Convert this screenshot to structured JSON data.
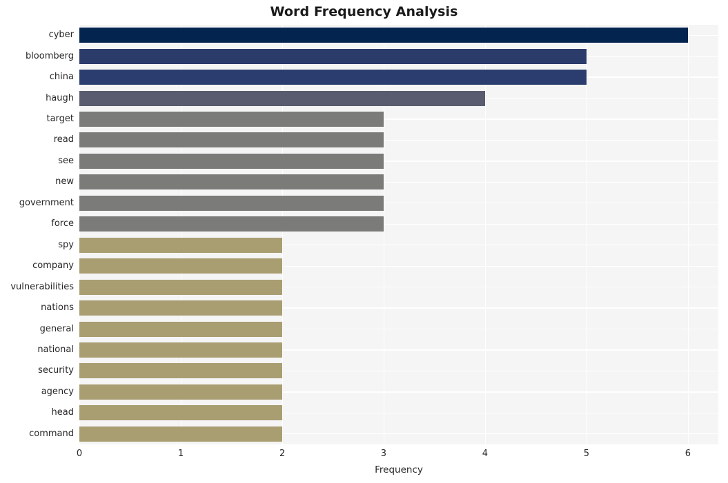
{
  "chart_data": {
    "type": "bar",
    "orientation": "horizontal",
    "title": "Word Frequency Analysis",
    "xlabel": "Frequency",
    "ylabel": "",
    "xlim": [
      0,
      6.3
    ],
    "xticks": [
      0,
      1,
      2,
      3,
      4,
      5,
      6
    ],
    "xticklabels": [
      "0",
      "1",
      "2",
      "3",
      "4",
      "5",
      "6"
    ],
    "grid": true,
    "legend": "none",
    "categories": [
      "cyber",
      "bloomberg",
      "china",
      "haugh",
      "target",
      "read",
      "see",
      "new",
      "government",
      "force",
      "spy",
      "company",
      "vulnerabilities",
      "nations",
      "general",
      "national",
      "security",
      "agency",
      "head",
      "command"
    ],
    "values": [
      6,
      5,
      5,
      4,
      3,
      3,
      3,
      3,
      3,
      3,
      2,
      2,
      2,
      2,
      2,
      2,
      2,
      2,
      2,
      2
    ],
    "bar_colors": [
      "#042450",
      "#2b3c6b",
      "#2a3d6e",
      "#585c6e",
      "#7b7b79",
      "#7b7b79",
      "#7b7b79",
      "#7b7b79",
      "#7b7b79",
      "#7b7b79",
      "#a99d72",
      "#a99d72",
      "#a99d72",
      "#a99d72",
      "#a99d72",
      "#a99d72",
      "#a99d72",
      "#a99d72",
      "#a99d72",
      "#a99d72"
    ],
    "plot_background": "#f5f5f5",
    "gridline_color": "#ffffff",
    "text_color": "#262626",
    "title_color": "#1a1a1a"
  }
}
